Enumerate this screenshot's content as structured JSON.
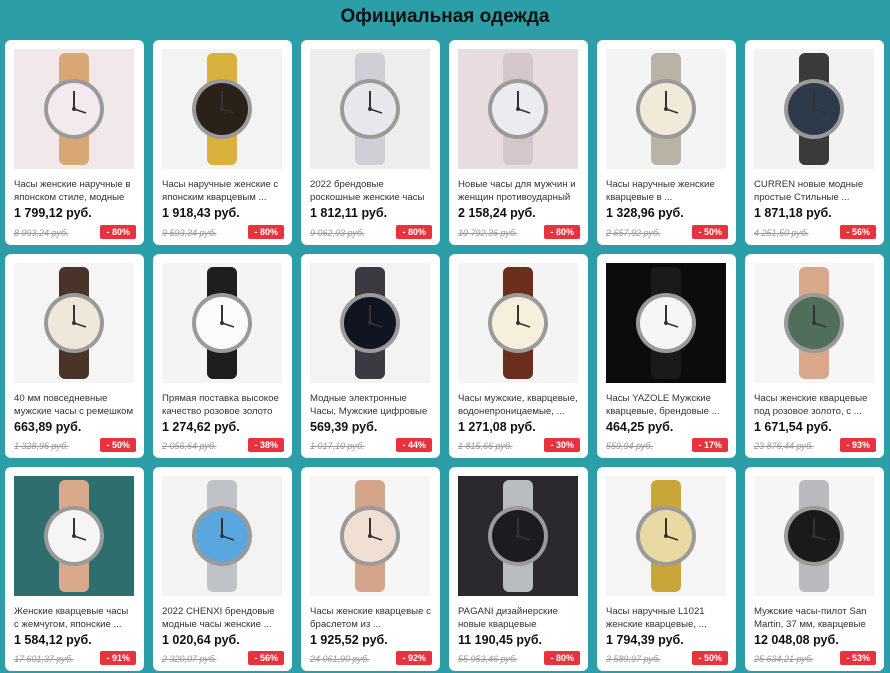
{
  "page": {
    "title": "Официальная одежда"
  },
  "products": [
    {
      "name": "Часы женские наручные в японском стиле, модные ...",
      "price": "1 799,12 руб.",
      "old_price": "8 993,24 руб.",
      "discount": "- 80%",
      "icon": "watch-icon",
      "face": "#f4e9ee",
      "band": "#d9a774",
      "bg": "#f1e8ea"
    },
    {
      "name": "Часы наручные женские с японским кварцевым ...",
      "price": "1 918,43 руб.",
      "old_price": "9 593,34 руб.",
      "discount": "- 80%",
      "icon": "watch-icon",
      "face": "#2a2218",
      "band": "#d8b23c",
      "bg": "#f3f3f3"
    },
    {
      "name": "2022 брендовые роскошные женские часы ...",
      "price": "1 812,11 руб.",
      "old_price": "9 062,93 руб.",
      "discount": "- 80%",
      "icon": "watch-icon",
      "face": "#e8e8ec",
      "band": "#cfd0d6",
      "bg": "#ededed"
    },
    {
      "name": "Новые часы для мужчин и женщин противоударный ...",
      "price": "2 158,24 руб.",
      "old_price": "10 792,36 руб.",
      "discount": "- 80%",
      "icon": "watch-icon",
      "face": "#ececf0",
      "band": "#d4c7cb",
      "bg": "#e8dcdf"
    },
    {
      "name": "Часы наручные женские кварцевые в ...",
      "price": "1 328,96 руб.",
      "old_price": "2 657,92 руб.",
      "discount": "- 50%",
      "icon": "watch-icon",
      "face": "#f1ead8",
      "band": "#b9b3a6",
      "bg": "#f4f4f4"
    },
    {
      "name": "CURREN новые модные простые Стильные ...",
      "price": "1 871,18 руб.",
      "old_price": "4 251,50 руб.",
      "discount": "- 56%",
      "icon": "watch-icon",
      "face": "#2c3a4c",
      "band": "#3a3a3a",
      "bg": "#f2f2f2"
    },
    {
      "name": "40 мм повседневные мужские часы с ремешком ...",
      "price": "663,89 руб.",
      "old_price": "1 328,96 руб.",
      "discount": "- 50%",
      "icon": "watch-icon",
      "face": "#efe8da",
      "band": "#4a3328",
      "bg": "#f5f5f5"
    },
    {
      "name": "Прямая поставка высокое качество розовое золото ...",
      "price": "1 274,62 руб.",
      "old_price": "2 056,64 руб.",
      "discount": "- 38%",
      "icon": "watch-icon",
      "face": "#fbfbfb",
      "band": "#1e1e1e",
      "bg": "#f4f4f4"
    },
    {
      "name": "Модные электронные Часы, Мужские цифровые ...",
      "price": "569,39 руб.",
      "old_price": "1 017,10 руб.",
      "discount": "- 44%",
      "icon": "watch-icon",
      "face": "#111522",
      "band": "#3a3a40",
      "bg": "#f3f3f3"
    },
    {
      "name": "Часы мужские, кварцевые, водонепроницаемые, ...",
      "price": "1 271,08 руб.",
      "old_price": "1 815,66 руб.",
      "discount": "- 30%",
      "icon": "watch-icon",
      "face": "#f6efdc",
      "band": "#6a2e1c",
      "bg": "#f4f4f4"
    },
    {
      "name": "Часы YAZOLE Мужские кварцевые, брендовые ...",
      "price": "464,25 руб.",
      "old_price": "559,94 руб.",
      "discount": "- 17%",
      "icon": "watch-icon",
      "face": "#f6f6f6",
      "band": "#1a1a1a",
      "bg": "#0c0c0c"
    },
    {
      "name": "Часы женские кварцевые под розовое золото, с ...",
      "price": "1 671,54 руб.",
      "old_price": "23 876,44 руб.",
      "discount": "- 93%",
      "icon": "watch-icon",
      "face": "#4f6f5a",
      "band": "#d7a98a",
      "bg": "#f6f6f6"
    },
    {
      "name": "Женские кварцевые часы с жемчугом, японские ...",
      "price": "1 584,12 руб.",
      "old_price": "17 601,37 руб.",
      "discount": "- 91%",
      "icon": "watch-icon",
      "face": "#f5f5f5",
      "band": "#d8a98b",
      "bg": "#2f6e6e"
    },
    {
      "name": "2022 CHENXI брендовые модные часы женские ...",
      "price": "1 020,64 руб.",
      "old_price": "2 320,07 руб.",
      "discount": "- 56%",
      "icon": "watch-icon",
      "face": "#5aa7df",
      "band": "#bfc3c8",
      "bg": "#f3f3f3"
    },
    {
      "name": "Часы женские кварцевые с браслетом из ...",
      "price": "1 925,52 руб.",
      "old_price": "24 061,90 руб.",
      "discount": "- 92%",
      "icon": "watch-icon",
      "face": "#f1dfd4",
      "band": "#d4a58b",
      "bg": "#f6f6f6"
    },
    {
      "name": "PAGANI дизайнерские новые кварцевые мужски...",
      "price": "11 190,45 руб.",
      "old_price": "55 953,46 руб.",
      "discount": "- 80%",
      "icon": "watch-icon",
      "face": "#1b1c22",
      "band": "#b9bcc0",
      "bg": "#2a2a2e"
    },
    {
      "name": "Часы наручные L1021 женские кварцевые, ...",
      "price": "1 794,39 руб.",
      "old_price": "3 589,97 руб.",
      "discount": "- 50%",
      "icon": "watch-icon",
      "face": "#e9d9a2",
      "band": "#c9a63a",
      "bg": "#f5f5f5"
    },
    {
      "name": "Мужские часы-пилот San Martin, 37 мм, кварцевые ...",
      "price": "12 048,08 руб.",
      "old_price": "25 634,21 руб.",
      "discount": "- 53%",
      "icon": "watch-icon",
      "face": "#1a1a1a",
      "band": "#b8babd",
      "bg": "#f6f6f6"
    }
  ]
}
